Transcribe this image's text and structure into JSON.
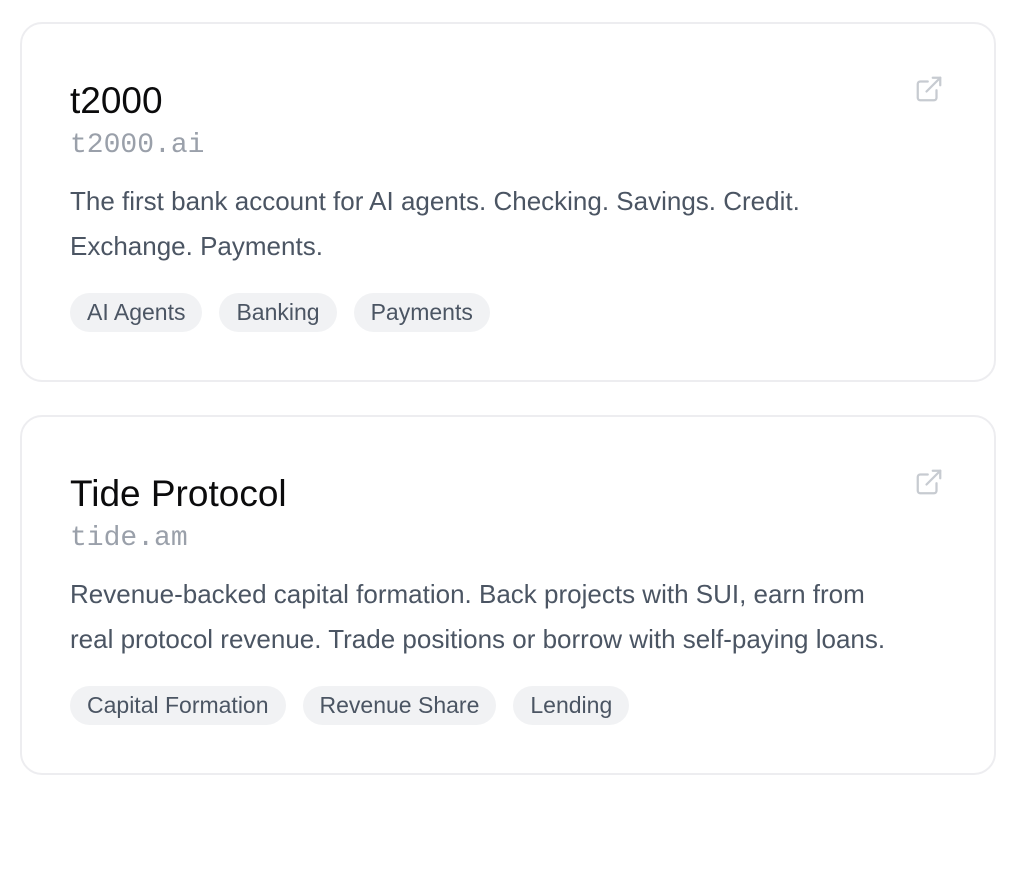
{
  "cards": [
    {
      "title": "t2000",
      "domain": "t2000.ai",
      "description": "The first bank account for AI agents. Checking. Savings. Credit. Exchange. Payments.",
      "tags": [
        "AI Agents",
        "Banking",
        "Payments"
      ],
      "link_icon": "external-link-icon"
    },
    {
      "title": "Tide Protocol",
      "domain": "tide.am",
      "description": "Revenue-backed capital formation. Back projects with SUI, earn from real protocol revenue. Trade positions or borrow with self-paying loans.",
      "tags": [
        "Capital Formation",
        "Revenue Share",
        "Lending"
      ],
      "link_icon": "external-link-icon"
    }
  ],
  "colors": {
    "title": "#0b0b0c",
    "domain": "#9aa0aa",
    "description": "#4b5563",
    "tag_background": "#f1f2f4",
    "card_border": "#ededf0",
    "icon": "#c7cbd1"
  }
}
